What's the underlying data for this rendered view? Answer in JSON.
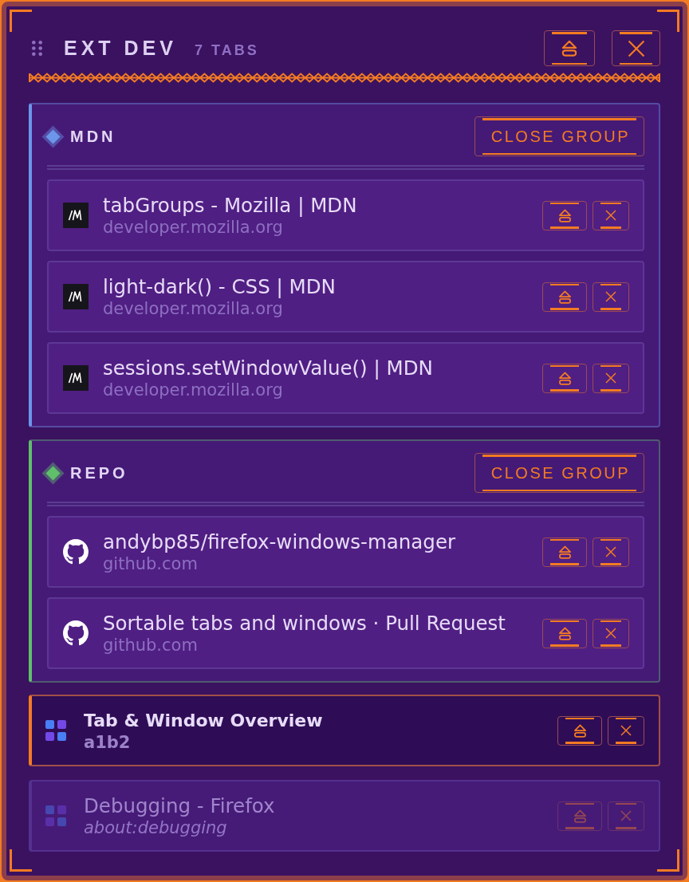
{
  "window": {
    "title": "EXT DEV",
    "tab_count": "7 TABS"
  },
  "groups": [
    {
      "name": "MDN",
      "color": "#6b96ea",
      "close_label": "CLOSE GROUP",
      "tabs": [
        {
          "title": "tabGroups - Mozilla | MDN",
          "url": "developer.mozilla.org",
          "kind": "mdn",
          "selected": false,
          "discarded": false
        },
        {
          "title": "light-dark() - CSS | MDN",
          "url": "developer.mozilla.org",
          "kind": "mdn",
          "selected": false,
          "discarded": false
        },
        {
          "title": "sessions.setWindowValue() | MDN",
          "url": "developer.mozilla.org",
          "kind": "mdn",
          "selected": false,
          "discarded": false
        }
      ]
    },
    {
      "name": "REPO",
      "color": "#5fbf6b",
      "close_label": "CLOSE GROUP",
      "tabs": [
        {
          "title": "andybp85/firefox-windows-manager",
          "url": "github.com",
          "kind": "github",
          "selected": false,
          "discarded": false
        },
        {
          "title": "Sortable tabs and windows · Pull Request",
          "url": "github.com",
          "kind": "github",
          "selected": false,
          "discarded": false
        }
      ]
    }
  ],
  "tabs": [
    {
      "title": "Tab & Window Overview",
      "url": "a1b2",
      "kind": "extension",
      "selected": true,
      "discarded": false
    },
    {
      "title": "Debugging - Firefox",
      "url": "about:debugging",
      "kind": "extension",
      "selected": false,
      "discarded": true
    }
  ]
}
